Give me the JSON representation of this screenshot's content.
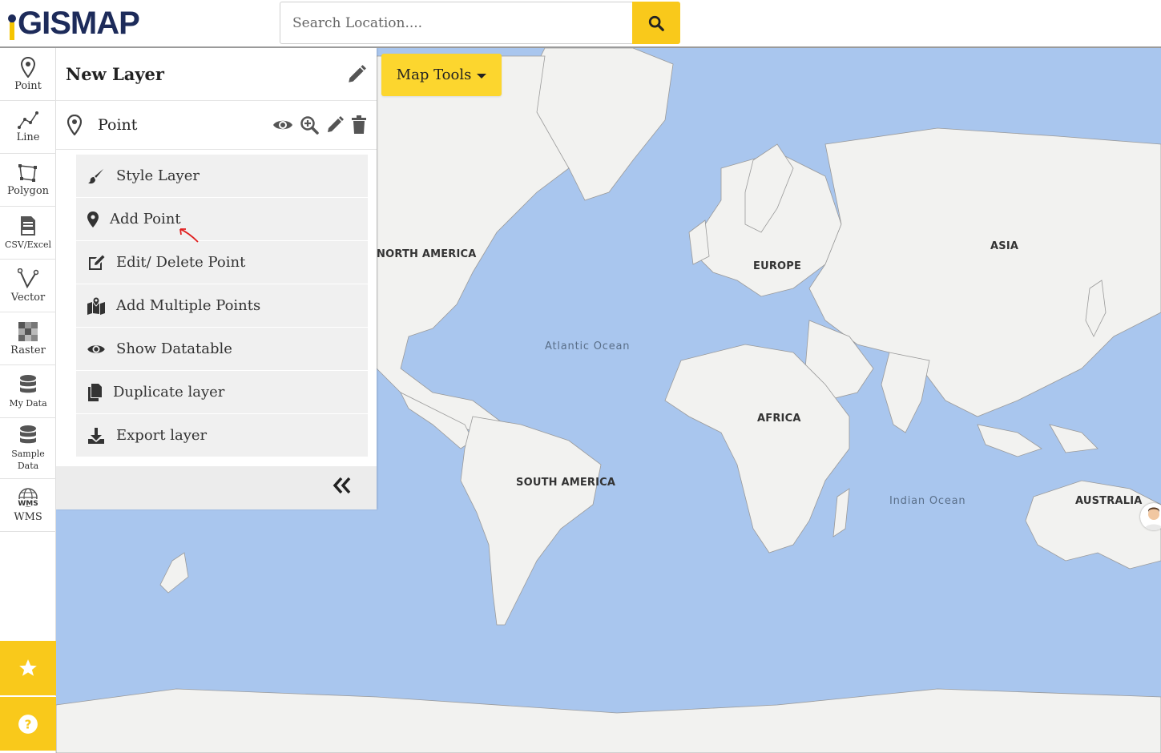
{
  "app": {
    "logo_text": "GISMAP"
  },
  "search": {
    "placeholder": "Search Location...."
  },
  "toolbar": {
    "items": [
      {
        "label": "Point"
      },
      {
        "label": "Line"
      },
      {
        "label": "Polygon"
      },
      {
        "label": "CSV/Excel"
      },
      {
        "label": "Vector"
      },
      {
        "label": "Raster"
      },
      {
        "label": "My Data"
      },
      {
        "label": "Sample Data"
      },
      {
        "label": "WMS"
      }
    ]
  },
  "panel": {
    "title": "New Layer",
    "layer": {
      "name": "Point"
    },
    "menu": [
      {
        "label": "Style Layer",
        "icon": "paintbrush-icon"
      },
      {
        "label": "Add Point",
        "icon": "map-marker-icon"
      },
      {
        "label": "Edit/ Delete Point",
        "icon": "edit-icon"
      },
      {
        "label": "Add Multiple Points",
        "icon": "map-markers-icon"
      },
      {
        "label": "Show Datatable",
        "icon": "eye-icon"
      },
      {
        "label": "Duplicate layer",
        "icon": "copy-icon"
      },
      {
        "label": "Export layer",
        "icon": "download-icon"
      }
    ]
  },
  "map": {
    "tools_label": "Map Tools",
    "continents": [
      "NORTH AMERICA",
      "EUROPE",
      "ASIA",
      "AFRICA",
      "SOUTH AMERICA",
      "AUSTRALIA"
    ],
    "oceans": [
      "Atlantic Ocean",
      "Indian Ocean"
    ]
  },
  "colors": {
    "accent": "#f9c91b",
    "ocean": "#a9c6ee",
    "land": "#f2f2f0",
    "brand": "#1d2b5a"
  }
}
